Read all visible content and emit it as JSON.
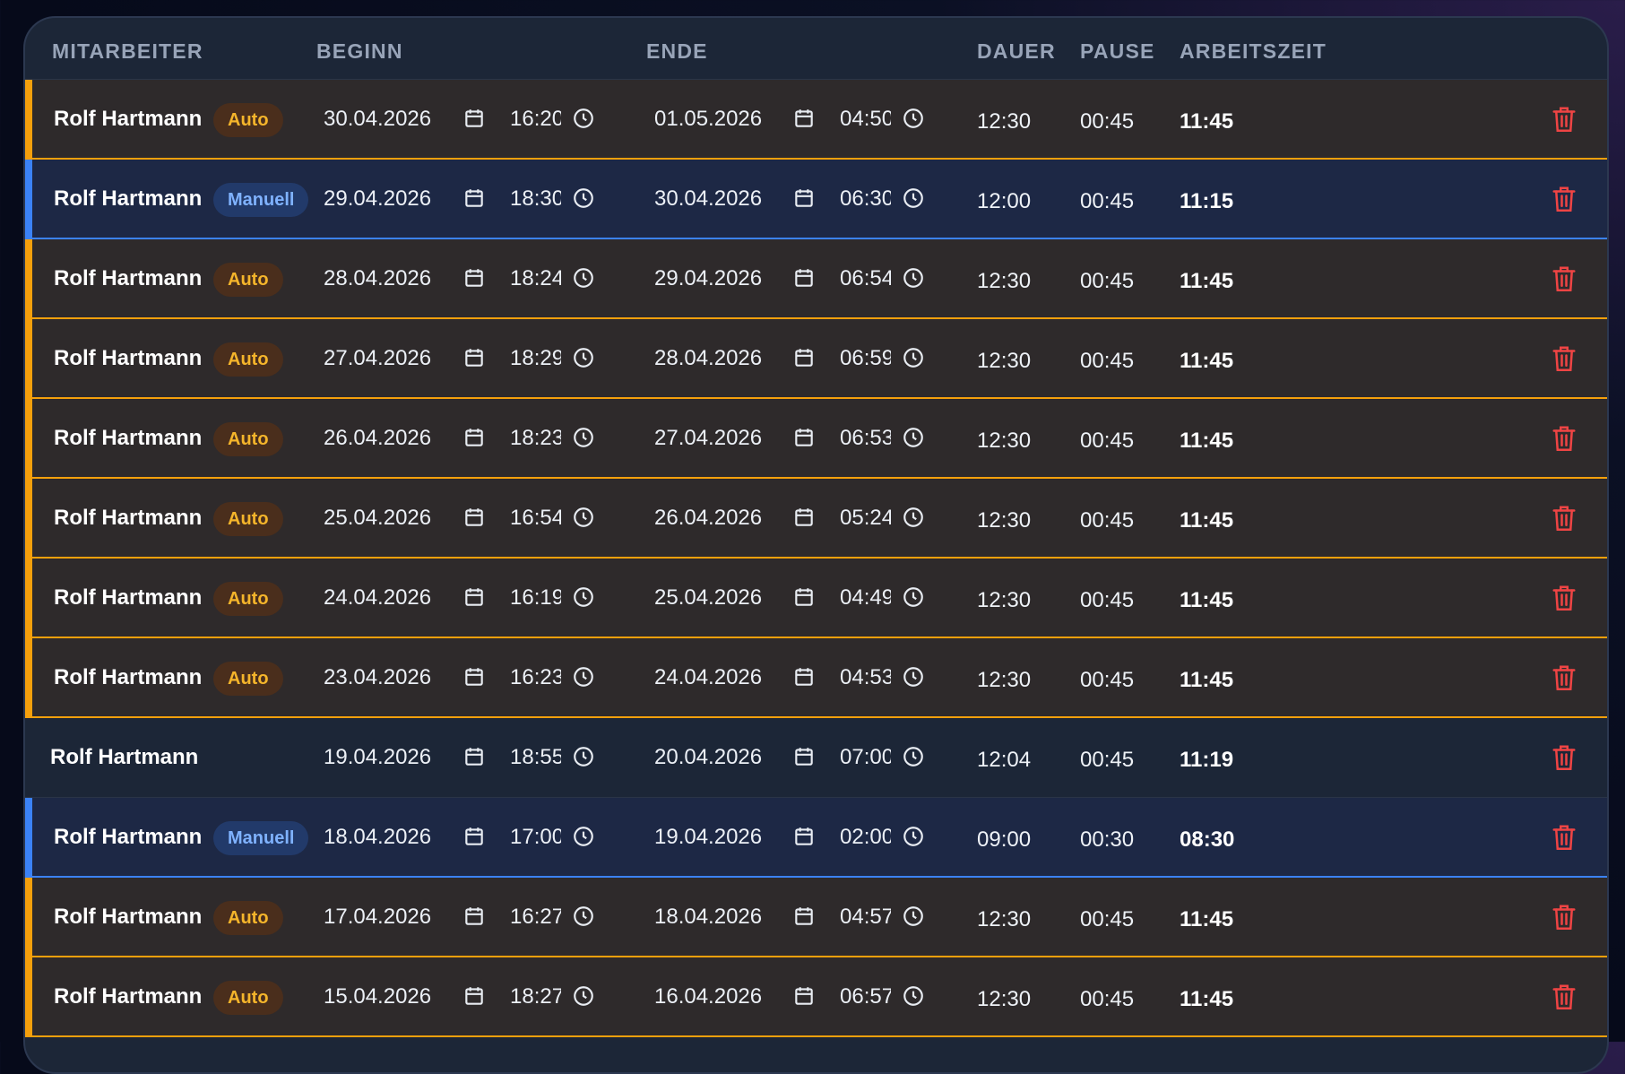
{
  "columns": {
    "employee": "MITARBEITER",
    "start": "BEGINN",
    "end": "ENDE",
    "duration": "DAUER",
    "break": "PAUSE",
    "worktime": "ARBEITSZEIT"
  },
  "colors": {
    "auto": "#f5a00c",
    "manual": "#3b82f6",
    "delete": "#ef4444"
  },
  "icons": {
    "date": "calendar-icon",
    "time": "clock-icon",
    "delete": "trash-icon"
  },
  "rows": [
    {
      "name": "Rolf Hartmann",
      "badge": "Auto",
      "kind": "auto",
      "start_date": "30.04.2026",
      "start_time": "16:20",
      "end_date": "01.05.2026",
      "end_time": "04:50",
      "duration": "12:30",
      "pause": "00:45",
      "worktime": "11:45"
    },
    {
      "name": "Rolf Hartmann",
      "badge": "Manuell",
      "kind": "manuell",
      "start_date": "29.04.2026",
      "start_time": "18:30",
      "end_date": "30.04.2026",
      "end_time": "06:30",
      "duration": "12:00",
      "pause": "00:45",
      "worktime": "11:15"
    },
    {
      "name": "Rolf Hartmann",
      "badge": "Auto",
      "kind": "auto",
      "start_date": "28.04.2026",
      "start_time": "18:24",
      "end_date": "29.04.2026",
      "end_time": "06:54",
      "duration": "12:30",
      "pause": "00:45",
      "worktime": "11:45"
    },
    {
      "name": "Rolf Hartmann",
      "badge": "Auto",
      "kind": "auto",
      "start_date": "27.04.2026",
      "start_time": "18:29",
      "end_date": "28.04.2026",
      "end_time": "06:59",
      "duration": "12:30",
      "pause": "00:45",
      "worktime": "11:45"
    },
    {
      "name": "Rolf Hartmann",
      "badge": "Auto",
      "kind": "auto",
      "start_date": "26.04.2026",
      "start_time": "18:23",
      "end_date": "27.04.2026",
      "end_time": "06:53",
      "duration": "12:30",
      "pause": "00:45",
      "worktime": "11:45"
    },
    {
      "name": "Rolf Hartmann",
      "badge": "Auto",
      "kind": "auto",
      "start_date": "25.04.2026",
      "start_time": "16:54",
      "end_date": "26.04.2026",
      "end_time": "05:24",
      "duration": "12:30",
      "pause": "00:45",
      "worktime": "11:45"
    },
    {
      "name": "Rolf Hartmann",
      "badge": "Auto",
      "kind": "auto",
      "start_date": "24.04.2026",
      "start_time": "16:19",
      "end_date": "25.04.2026",
      "end_time": "04:49",
      "duration": "12:30",
      "pause": "00:45",
      "worktime": "11:45"
    },
    {
      "name": "Rolf Hartmann",
      "badge": "Auto",
      "kind": "auto",
      "start_date": "23.04.2026",
      "start_time": "16:23",
      "end_date": "24.04.2026",
      "end_time": "04:53",
      "duration": "12:30",
      "pause": "00:45",
      "worktime": "11:45"
    },
    {
      "name": "Rolf Hartmann",
      "badge": "",
      "kind": "neutral",
      "start_date": "19.04.2026",
      "start_time": "18:55",
      "end_date": "20.04.2026",
      "end_time": "07:00",
      "duration": "12:04",
      "pause": "00:45",
      "worktime": "11:19"
    },
    {
      "name": "Rolf Hartmann",
      "badge": "Manuell",
      "kind": "manuell",
      "start_date": "18.04.2026",
      "start_time": "17:00",
      "end_date": "19.04.2026",
      "end_time": "02:00",
      "duration": "09:00",
      "pause": "00:30",
      "worktime": "08:30"
    },
    {
      "name": "Rolf Hartmann",
      "badge": "Auto",
      "kind": "auto",
      "start_date": "17.04.2026",
      "start_time": "16:27",
      "end_date": "18.04.2026",
      "end_time": "04:57",
      "duration": "12:30",
      "pause": "00:45",
      "worktime": "11:45"
    },
    {
      "name": "Rolf Hartmann",
      "badge": "Auto",
      "kind": "auto",
      "start_date": "15.04.2026",
      "start_time": "18:27",
      "end_date": "16.04.2026",
      "end_time": "06:57",
      "duration": "12:30",
      "pause": "00:45",
      "worktime": "11:45"
    }
  ]
}
